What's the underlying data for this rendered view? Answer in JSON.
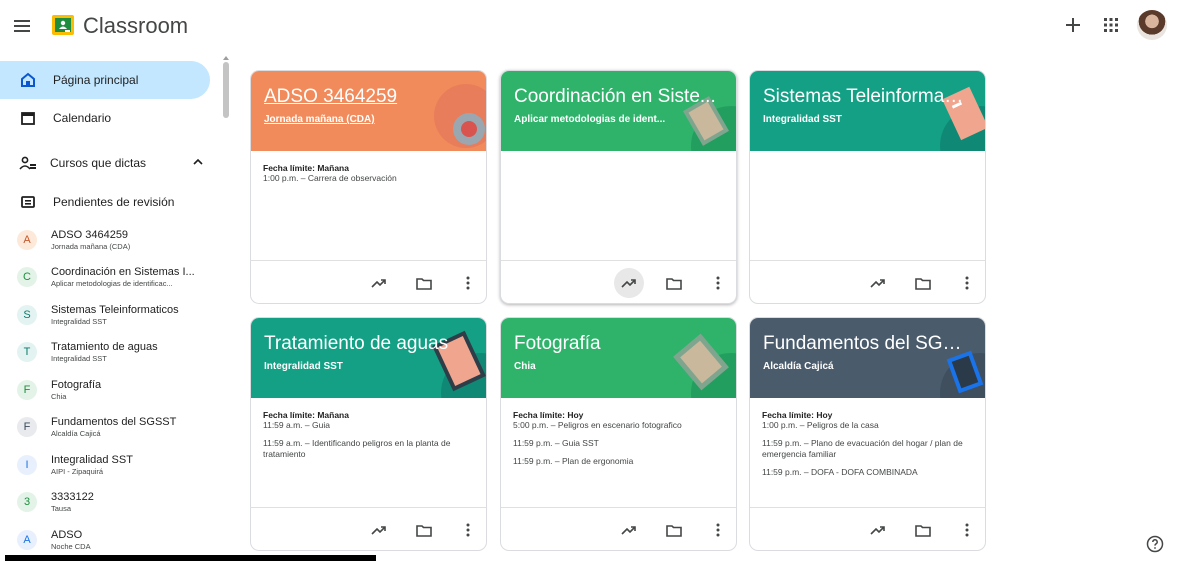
{
  "app": {
    "title": "Classroom"
  },
  "sidebar": {
    "home_label": "Página principal",
    "calendar_label": "Calendario",
    "teaching_label": "Cursos que dictas",
    "review_label": "Pendientes de revisión",
    "courses": [
      {
        "letter": "A",
        "title": "ADSO 3464259",
        "sub": "Jornada mañana (CDA)",
        "color": "#fde9d9",
        "fg": "#c5562a"
      },
      {
        "letter": "C",
        "title": "Coordinación en Sistemas I...",
        "sub": "Aplicar metodologias de identificac...",
        "color": "#e3f3e8",
        "fg": "#1e8e3e"
      },
      {
        "letter": "S",
        "title": "Sistemas Teleinformaticos",
        "sub": "Integralidad SST",
        "color": "#e3f3f1",
        "fg": "#0b7a6b"
      },
      {
        "letter": "T",
        "title": "Tratamiento de aguas",
        "sub": "Integralidad SST",
        "color": "#e3f3f1",
        "fg": "#0b7a6b"
      },
      {
        "letter": "F",
        "title": "Fotografía",
        "sub": "Chia",
        "color": "#e3f3e8",
        "fg": "#1e8e3e"
      },
      {
        "letter": "F",
        "title": "Fundamentos del SGSST",
        "sub": "Alcaldía Cajicá",
        "color": "#e8eaed",
        "fg": "#3c4a5a"
      },
      {
        "letter": "I",
        "title": "Integralidad SST",
        "sub": "AIPI - Zipaquirá",
        "color": "#e8f0fe",
        "fg": "#1a73e8"
      },
      {
        "letter": "3",
        "title": "3333122",
        "sub": "Tausa",
        "color": "#e3f3e8",
        "fg": "#1e8e3e"
      },
      {
        "letter": "A",
        "title": "ADSO",
        "sub": "Noche CDA",
        "color": "#e8f0fe",
        "fg": "#1a73e8"
      }
    ]
  },
  "cards": [
    {
      "title": "ADSO 3464259",
      "sub": "Jornada mañana (CDA)",
      "color": "#f28b5b",
      "link": true,
      "due_label": "Fecha límite: Mañana",
      "lines": [
        "1:00 p.m. – Carrera de observación"
      ]
    },
    {
      "title": "Coordinación en Siste...",
      "sub": "Aplicar metodologias de ident...",
      "color": "#2fb36b",
      "link": false,
      "due_label": "",
      "lines": []
    },
    {
      "title": "Sistemas Teleinformati...",
      "sub": "Integralidad SST",
      "color": "#14a085",
      "link": false,
      "due_label": "",
      "lines": []
    },
    {
      "title": "Tratamiento de aguas",
      "sub": "Integralidad SST",
      "color": "#14a085",
      "link": false,
      "due_label": "Fecha límite: Mañana",
      "lines": [
        "11:59 a.m. – Guia",
        "11:59 a.m. – Identificando peligros en la planta de tratamiento"
      ]
    },
    {
      "title": "Fotografía",
      "sub": "Chia",
      "color": "#2fb36b",
      "link": false,
      "due_label": "Fecha límite: Hoy",
      "lines": [
        "5:00 p.m. – Peligros en escenario fotografico",
        "11:59 p.m. – Guia SST",
        "11:59 p.m. – Plan de ergonomia"
      ]
    },
    {
      "title": "Fundamentos del SGSST",
      "sub": "Alcaldía Cajicá",
      "color": "#4a5b6c",
      "link": false,
      "due_label": "Fecha límite: Hoy",
      "lines": [
        "1:00 p.m. – Peligros de la casa",
        "11:59 p.m. – Plano de evacuación del hogar / plan de emergencia familiar",
        "11:59 p.m. – DOFA - DOFA COMBINADA"
      ]
    }
  ],
  "colors": {
    "active_nav": "#c2e7ff",
    "logo_green": "#1e8e3e",
    "logo_yellow": "#fbbc04"
  }
}
